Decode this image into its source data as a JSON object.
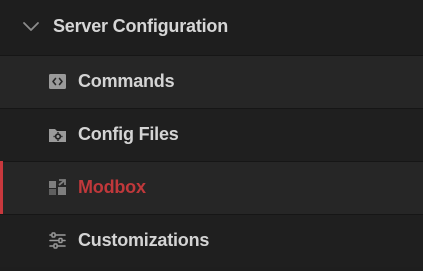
{
  "group": {
    "title": "Server Configuration",
    "expanded_icon": "chevron-down-icon"
  },
  "items": [
    {
      "label": "Commands",
      "icon": "code-icon",
      "active": false
    },
    {
      "label": "Config Files",
      "icon": "folder-gear-icon",
      "active": false
    },
    {
      "label": "Modbox",
      "icon": "modbox-icon",
      "active": true
    },
    {
      "label": "Customizations",
      "icon": "sliders-icon",
      "active": false
    }
  ],
  "colors": {
    "background": "#1e1e1e",
    "text": "#d4d4d4",
    "active_text": "#c0383b",
    "active_bar": "#c8383d",
    "icon": "#9a9a9a"
  }
}
